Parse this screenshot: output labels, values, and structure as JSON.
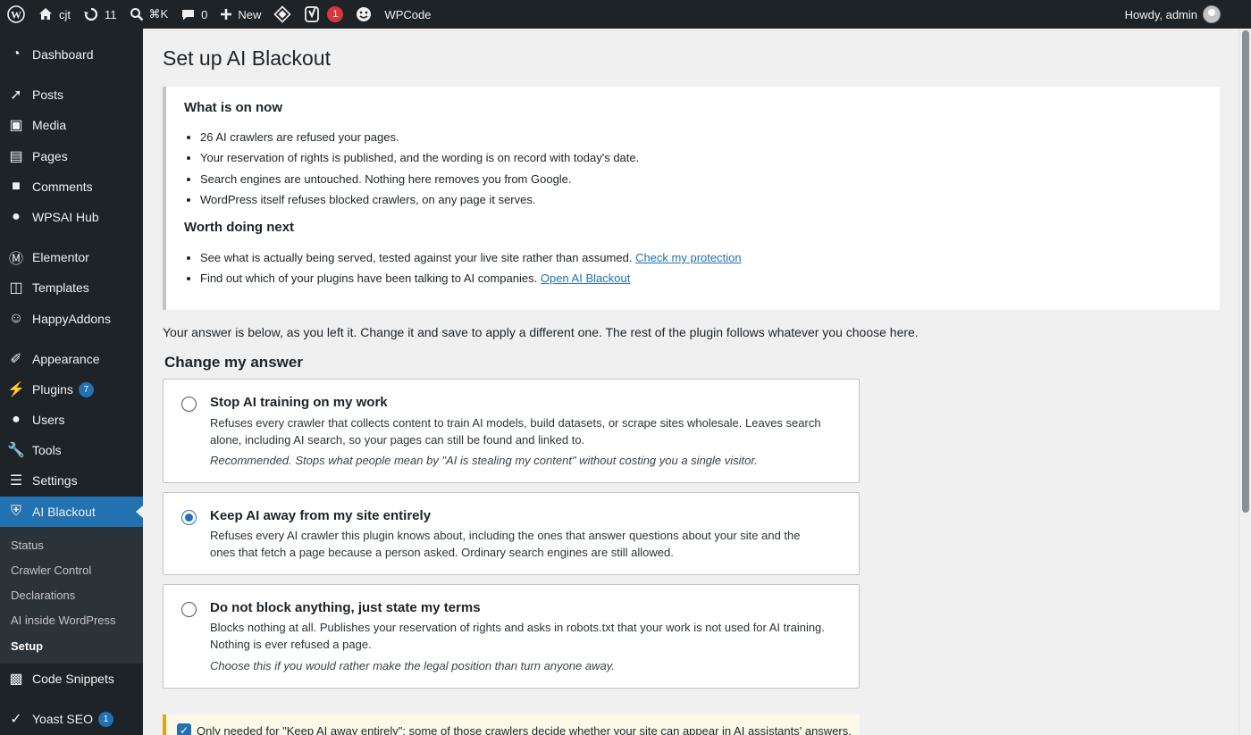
{
  "adminbar": {
    "site_name": "cjt",
    "updates_count": "11",
    "search_shortcut": "⌘K",
    "comments_count": "0",
    "new_label": "New",
    "yoast_badge": "1",
    "wpcode_label": "WPCode",
    "howdy": "Howdy, admin"
  },
  "sidebar": {
    "items": [
      {
        "label": "Dashboard"
      },
      {
        "label": "Posts"
      },
      {
        "label": "Media"
      },
      {
        "label": "Pages"
      },
      {
        "label": "Comments"
      },
      {
        "label": "WPSAI Hub"
      },
      {
        "label": "Elementor"
      },
      {
        "label": "Templates"
      },
      {
        "label": "HappyAddons"
      },
      {
        "label": "Appearance"
      },
      {
        "label": "Plugins",
        "count": "7"
      },
      {
        "label": "Users"
      },
      {
        "label": "Tools"
      },
      {
        "label": "Settings"
      },
      {
        "label": "AI Blackout"
      },
      {
        "label": "Code Snippets"
      },
      {
        "label": "Yoast SEO",
        "count": "1"
      }
    ],
    "submenu": [
      "Status",
      "Crawler Control",
      "Declarations",
      "AI inside WordPress",
      "Setup"
    ]
  },
  "page": {
    "title": "Set up AI Blackout",
    "notice": {
      "heading_on": "What is on now",
      "on_items": [
        "26 AI crawlers are refused your pages.",
        "Your reservation of rights is published, and the wording is on record with today's date.",
        "Search engines are untouched. Nothing here removes you from Google.",
        "WordPress itself refuses blocked crawlers, on any page it serves."
      ],
      "heading_next": "Worth doing next",
      "next_items": [
        {
          "text": "See what is actually being served, tested against your live site rather than assumed.",
          "link": "Check my protection"
        },
        {
          "text": "Find out which of your plugins have been talking to AI companies.",
          "link": "Open AI Blackout"
        }
      ]
    },
    "intro": "Your answer is below, as you left it. Change it and save to apply a different one. The rest of the plugin follows whatever you choose here.",
    "change_heading": "Change my answer",
    "options": [
      {
        "title": "Stop AI training on my work",
        "desc": "Refuses every crawler that collects content to train AI models, build datasets, or scrape sites wholesale. Leaves search alone, including AI search, so your pages can still be found and linked to.",
        "note": "Recommended. Stops what people mean by \"AI is stealing my content\" without costing you a single visitor.",
        "checked": false
      },
      {
        "title": "Keep AI away from my site entirely",
        "desc": "Refuses every AI crawler this plugin knows about, including the ones that answer questions about your site and the ones that fetch a page because a person asked. Ordinary search engines are still allowed.",
        "note": "",
        "checked": true
      },
      {
        "title": "Do not block anything, just state my terms",
        "desc": "Blocks nothing at all. Publishes your reservation of rights and asks in robots.txt that your work is not used for AI training. Nothing is ever refused a page.",
        "note": "Choose this if you would rather make the legal position than turn anyone away.",
        "checked": false
      }
    ],
    "bottom_notice": "Only needed for \"Keep AI away entirely\": some of those crawlers decide whether your site can appear in AI assistants' answers."
  }
}
